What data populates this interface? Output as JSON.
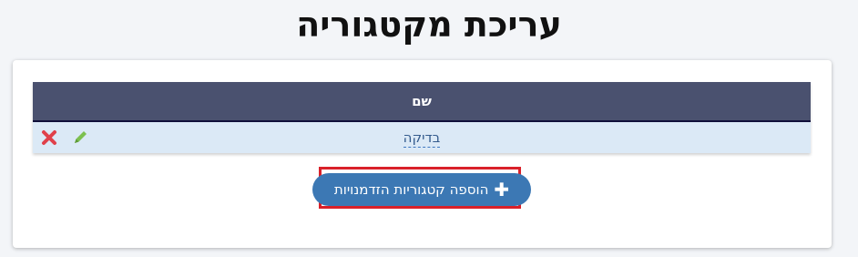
{
  "page": {
    "title": "עריכת מקטגוריה"
  },
  "table": {
    "header_name": "שם",
    "rows": [
      {
        "name": "בדיקה"
      }
    ]
  },
  "actions": {
    "add_label": "הוספה קטגוריות הזדמנויות"
  },
  "icons": {
    "add": "plus-icon",
    "edit": "pencil-icon",
    "delete": "close-icon"
  },
  "colors": {
    "header_bg": "#4a516f",
    "row_bg": "#dbe9f6",
    "button_bg": "#3c78b4",
    "highlight": "#d9212a",
    "edit": "#7cc04f",
    "delete": "#e0404a"
  }
}
